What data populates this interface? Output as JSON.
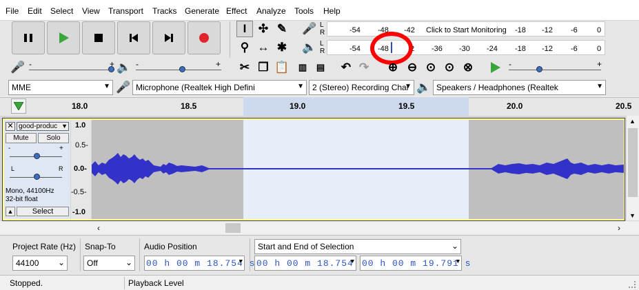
{
  "menu": [
    "File",
    "Edit",
    "Select",
    "View",
    "Transport",
    "Tracks",
    "Generate",
    "Effect",
    "Analyze",
    "Tools",
    "Help"
  ],
  "meters": {
    "record_ticks": [
      "-54",
      "-48",
      "-42"
    ],
    "record_prompt": "Click to Start Monitoring",
    "record_ticks_right": [
      "-18",
      "-12",
      "-6",
      "0"
    ],
    "playback_ticks": [
      "-54",
      "-48",
      "2",
      "-36",
      "-30",
      "-24",
      "-18",
      "-12",
      "-6",
      "0"
    ],
    "channel_l": "L",
    "channel_r": "R",
    "slider_minus": "-",
    "slider_plus": "+"
  },
  "device": {
    "host": "MME",
    "mic": "Microphone (Realtek High Defini",
    "channels": "2 (Stereo) Recording Chai",
    "speakers": "Speakers / Headphones (Realtek"
  },
  "ruler": [
    "18.0",
    "18.5",
    "19.0",
    "19.5",
    "20.0",
    "20.5"
  ],
  "track": {
    "name": "good-produc",
    "mute": "Mute",
    "solo": "Solo",
    "gain_minus": "-",
    "gain_plus": "+",
    "pan_l": "L",
    "pan_r": "R",
    "info1": "Mono, 44100Hz",
    "info2": "32-bit float",
    "select": "Select",
    "scale": [
      "1.0",
      "0.5-",
      "0.0-",
      "-0.5-",
      "-1.0"
    ]
  },
  "selection_bar": {
    "project_rate_label": "Project Rate (Hz)",
    "project_rate": "44100",
    "snap_label": "Snap-To",
    "snap": "Off",
    "audio_pos_label": "Audio Position",
    "audio_pos": "00 h 00 m 18.754 s",
    "sel_mode": "Start and End of Selection",
    "sel_start": "00 h 00 m 18.754 s",
    "sel_end": "00 h 00 m 19.791 s"
  },
  "status": {
    "left": "Stopped.",
    "right": "Playback Level"
  },
  "colors": {
    "waveform": "#3232c8",
    "selection": "#e8eef9",
    "annotation": "#ff0000"
  }
}
